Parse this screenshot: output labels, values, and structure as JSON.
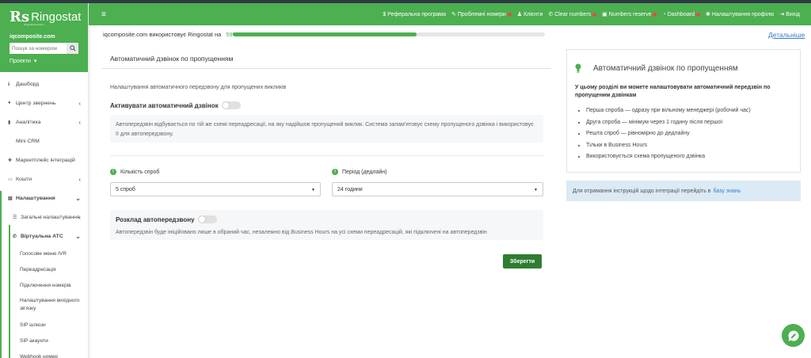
{
  "sidebar": {
    "logo": "Ringostat",
    "logo_sub": "Ringostat Analytics",
    "domain": "iqcomposite.com",
    "search_placeholder": "Пошук за номером",
    "projects_label": "Проекти",
    "items": [
      {
        "label": "Дашборд",
        "icon": "info-icon"
      },
      {
        "label": "Центр звернень",
        "icon": "chat-icon"
      },
      {
        "label": "Аналітика",
        "icon": "chart-icon"
      },
      {
        "label": "Mini CRM",
        "icon": "crm-icon"
      },
      {
        "label": "Маркетплейс інтеграцій",
        "icon": "puzzle-icon"
      },
      {
        "label": "Кошти",
        "icon": "wallet-icon"
      },
      {
        "label": "Налаштування",
        "icon": "settings-icon"
      },
      {
        "label": "Загальні налаштування",
        "icon": "list-icon"
      },
      {
        "label": "Віртуальна АТС",
        "icon": "phone-icon"
      }
    ],
    "sub_items": [
      "Голосове меню IVR",
      "Переадресація",
      "Підключення номерів",
      "Налаштування вихідного зв'язку",
      "SIP шлюзи",
      "SIP акаунти",
      "Webhook номер"
    ]
  },
  "topbar": {
    "links": [
      {
        "label": "Реферальна програма",
        "icon": "dollar-icon",
        "alert": false
      },
      {
        "label": "Проблемні номери",
        "icon": "wrench-icon",
        "alert": true
      },
      {
        "label": "Клієнти",
        "icon": "user-icon",
        "alert": false
      },
      {
        "label": "Clear numbers",
        "icon": "phone-icon",
        "alert": true
      },
      {
        "label": "Numbers reserve",
        "icon": "reserve-icon",
        "alert": true
      },
      {
        "label": "Dashboard",
        "icon": "dashboard-icon",
        "alert": true
      },
      {
        "label": "Налаштування профілю",
        "icon": "gear-icon",
        "alert": false
      },
      {
        "label": "Вихід",
        "icon": "logout-icon",
        "alert": false
      }
    ]
  },
  "usage": {
    "text": "iqcomposite.com використовує Ringostat на",
    "percent_label": "59%",
    "percent": 0.59,
    "details_link": "Детальніше"
  },
  "main": {
    "title": "Автоматичний дзвінок по пропущенням",
    "description": "Налаштування автоматичного передзвону для пропущених викликів",
    "activate_label": "Активувати автоматичний дзвінок",
    "activate_info": "Автопередзвін відбувається по тій же схемі переадресації, на яку надійшов пропущений виклик. Система запам'ятовує схему пропущеного дзвінка і використовує її для автопередзвону.",
    "attempts_label": "Кількість спроб",
    "attempts_value": "5 спроб",
    "period_label": "Період (дедлайн)",
    "period_value": "24 години",
    "schedule_label": "Розклад автопередзвону",
    "schedule_info": "Автопередзвін буде ініційовано лише в обраний час, незалежно від Business Hours на усі схеми переадресацій, які підключені на автопередзвін",
    "save_label": "Зберегти"
  },
  "help": {
    "title": "Автоматичний дзвінок по пропущенням",
    "intro": "У цьому розділі ви можете налаштовувати автоматичний передзвін по пропущеним дзвінкам",
    "bullets": [
      "Перша спроба — одразу при вільному менеджері (робочий час)",
      "Друга спроба — мінімум через 1 годину після першої",
      "Решта спроб — рівномірно до дедлайну",
      "Тільки в Business Hours",
      "Використовується схема пропущеного дзвінка"
    ],
    "kb_text": "Для отримання інструкцій щодо інтеграції перейдіть в",
    "kb_link": "базу знань"
  },
  "colors": {
    "brand": "#4caf50",
    "save": "#2e7d32",
    "link": "#3a7bc8",
    "alert": "#e74c3c"
  }
}
